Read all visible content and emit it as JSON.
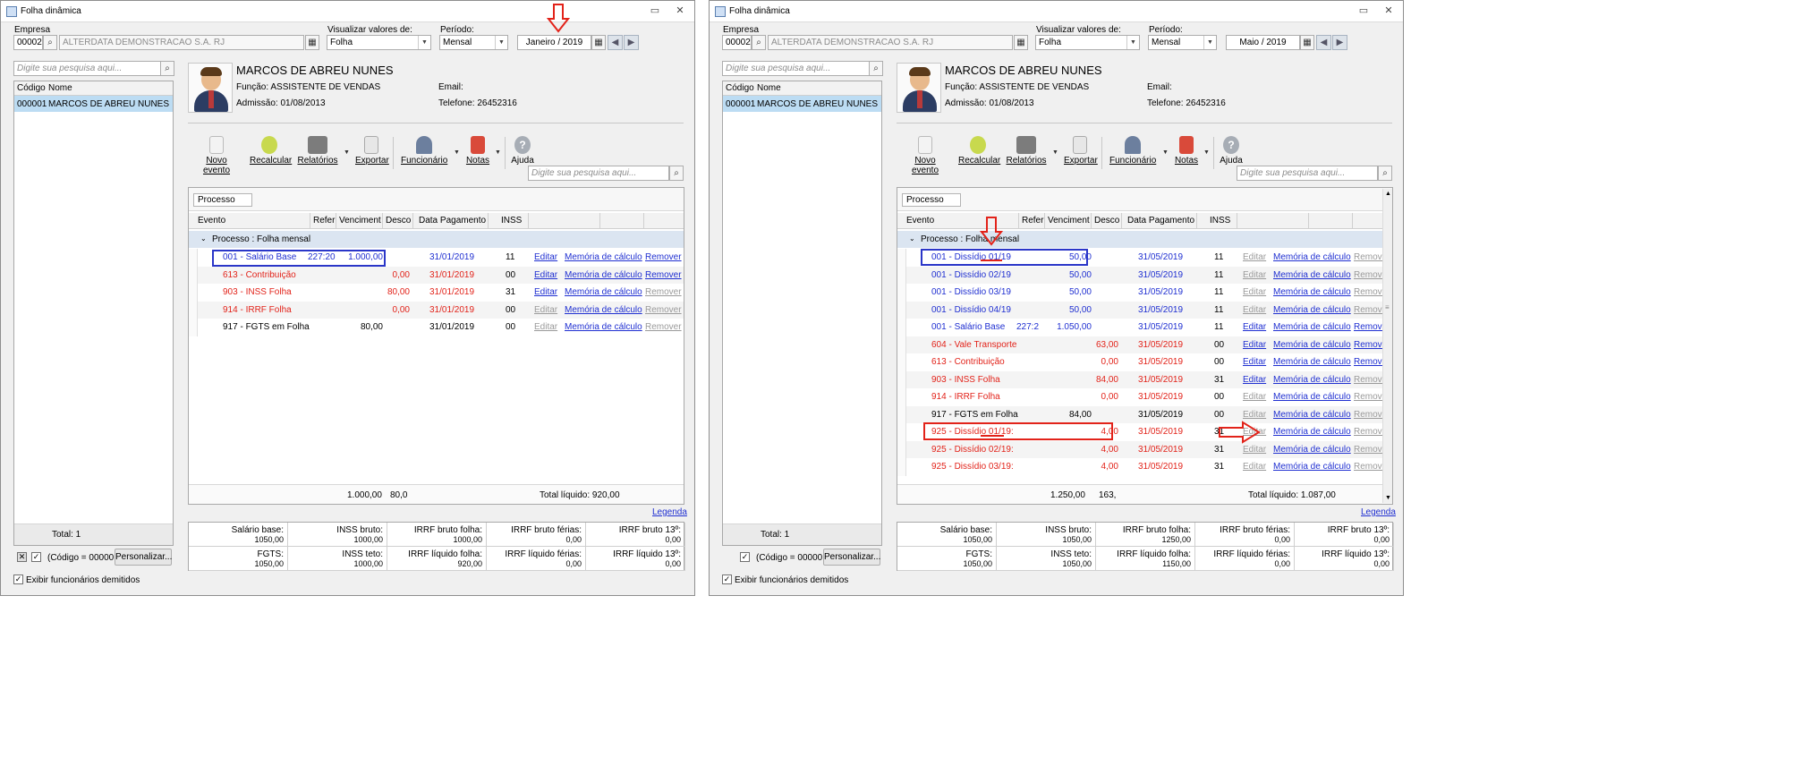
{
  "window_title": "Folha dinâmica",
  "labels": {
    "empresa": "Empresa",
    "visualizar": "Visualizar valores de:",
    "periodo": "Período:",
    "search_placeholder": "Digite sua pesquisa aqui...",
    "col_codigo": "Código",
    "col_nome": "Nome",
    "total_list": "Total: 1",
    "filter_text": "(Código = 00000",
    "personalizar": "Personalizar...",
    "exibir_demitidos": "Exibir funcionários demitidos",
    "processo_btn": "Processo",
    "legenda": "Legenda",
    "group_label": "Processo : Folha mensal"
  },
  "company": {
    "code": "00002",
    "name": "ALTERDATA DEMONSTRACAO S.A. RJ"
  },
  "view_values": "Folha",
  "period_type": "Mensal",
  "employee": {
    "code": "000001",
    "name": "MARCOS DE ABREU NUNES",
    "funcao": "Função: ASSISTENTE DE VENDAS",
    "admissao": "Admissão: 01/08/2013",
    "email": "Email:",
    "telefone": "Telefone: 26452316"
  },
  "toolbar": {
    "novo_evento": "Novo evento",
    "recalcular": "Recalcular",
    "relatorios": "Relatórios",
    "exportar": "Exportar",
    "funcionario": "Funcionário",
    "notas": "Notas",
    "ajuda": "Ajuda"
  },
  "columns": [
    "Evento",
    "Refer",
    "Venciment",
    "Desco",
    "Data Pagamento",
    "INSS"
  ],
  "actions": {
    "editar": "Editar",
    "memoria": "Memória de cálculo",
    "remover": "Remover"
  },
  "summary_labels": [
    "Salário base:",
    "INSS bruto:",
    "IRRF bruto folha:",
    "IRRF bruto férias:",
    "IRRF bruto 13º:",
    "FGTS:",
    "INSS teto:",
    "IRRF líquido folha:",
    "IRRF líquido férias:",
    "IRRF líquido 13º:"
  ],
  "left": {
    "period": "Janeiro / 2019",
    "rows": [
      {
        "evento": "001 - Salário Base",
        "refer": "227:20",
        "venc": "1.000,00",
        "desc": "",
        "data": "31/01/2019",
        "inss": "11",
        "color": "blue",
        "ed": true,
        "rm": true
      },
      {
        "evento": "613 - Contribuição",
        "refer": "",
        "venc": "",
        "desc": "0,00",
        "data": "31/01/2019",
        "inss": "00",
        "color": "red",
        "ed": true,
        "rm": true
      },
      {
        "evento": "903 - INSS Folha",
        "refer": "",
        "venc": "",
        "desc": "80,00",
        "data": "31/01/2019",
        "inss": "31",
        "color": "red",
        "ed": true,
        "rm": false
      },
      {
        "evento": "914 - IRRF Folha",
        "refer": "",
        "venc": "",
        "desc": "0,00",
        "data": "31/01/2019",
        "inss": "00",
        "color": "red",
        "ed": false,
        "rm": false
      },
      {
        "evento": "917 - FGTS em Folha",
        "refer": "",
        "venc": "80,00",
        "desc": "",
        "data": "31/01/2019",
        "inss": "00",
        "color": "dk",
        "ed": false,
        "rm": false
      }
    ],
    "foot_venc": "1.000,00",
    "foot_desc": "80,0",
    "total_liquido": "Total líquido: 920,00",
    "summary_values": [
      "1050,00",
      "1000,00",
      "1000,00",
      "0,00",
      "0,00",
      "1050,00",
      "1000,00",
      "920,00",
      "0,00",
      "0,00"
    ]
  },
  "right": {
    "period": "Maio / 2019",
    "rows": [
      {
        "evento": "001 - Dissídio 01/19",
        "refer": "",
        "venc": "50,00",
        "desc": "",
        "data": "31/05/2019",
        "inss": "11",
        "color": "blue",
        "ed": false,
        "rm": false
      },
      {
        "evento": "001 - Dissídio 02/19",
        "refer": "",
        "venc": "50,00",
        "desc": "",
        "data": "31/05/2019",
        "inss": "11",
        "color": "blue",
        "ed": false,
        "rm": false
      },
      {
        "evento": "001 - Dissídio 03/19",
        "refer": "",
        "venc": "50,00",
        "desc": "",
        "data": "31/05/2019",
        "inss": "11",
        "color": "blue",
        "ed": false,
        "rm": false
      },
      {
        "evento": "001 - Dissídio 04/19",
        "refer": "",
        "venc": "50,00",
        "desc": "",
        "data": "31/05/2019",
        "inss": "11",
        "color": "blue",
        "ed": false,
        "rm": false
      },
      {
        "evento": "001 - Salário Base",
        "refer": "227:2",
        "venc": "1.050,00",
        "desc": "",
        "data": "31/05/2019",
        "inss": "11",
        "color": "blue",
        "ed": true,
        "rm": true
      },
      {
        "evento": "604 - Vale Transporte",
        "refer": "",
        "venc": "",
        "desc": "63,00",
        "data": "31/05/2019",
        "inss": "00",
        "color": "red",
        "ed": true,
        "rm": true
      },
      {
        "evento": "613 - Contribuição",
        "refer": "",
        "venc": "",
        "desc": "0,00",
        "data": "31/05/2019",
        "inss": "00",
        "color": "red",
        "ed": true,
        "rm": true
      },
      {
        "evento": "903 - INSS Folha",
        "refer": "",
        "venc": "",
        "desc": "84,00",
        "data": "31/05/2019",
        "inss": "31",
        "color": "red",
        "ed": true,
        "rm": false
      },
      {
        "evento": "914 - IRRF Folha",
        "refer": "",
        "venc": "",
        "desc": "0,00",
        "data": "31/05/2019",
        "inss": "00",
        "color": "red",
        "ed": false,
        "rm": false
      },
      {
        "evento": "917 - FGTS em Folha",
        "refer": "",
        "venc": "84,00",
        "desc": "",
        "data": "31/05/2019",
        "inss": "00",
        "color": "dk",
        "ed": false,
        "rm": false
      },
      {
        "evento": "925 - Dissídio 01/19:",
        "refer": "",
        "venc": "",
        "desc": "4,00",
        "data": "31/05/2019",
        "inss": "31",
        "color": "red",
        "ed": false,
        "rm": false
      },
      {
        "evento": "925 - Dissídio 02/19:",
        "refer": "",
        "venc": "",
        "desc": "4,00",
        "data": "31/05/2019",
        "inss": "31",
        "color": "red",
        "ed": false,
        "rm": false
      },
      {
        "evento": "925 - Dissídio 03/19:",
        "refer": "",
        "venc": "",
        "desc": "4,00",
        "data": "31/05/2019",
        "inss": "31",
        "color": "red",
        "ed": false,
        "rm": false
      }
    ],
    "foot_venc": "1.250,00",
    "foot_desc": "163,",
    "total_liquido": "Total líquido: 1.087,00",
    "summary_values": [
      "1050,00",
      "1050,00",
      "1250,00",
      "0,00",
      "0,00",
      "1050,00",
      "1050,00",
      "1150,00",
      "0,00",
      "0,00"
    ]
  },
  "colors": {
    "blue": "#1f2fd1",
    "red": "#e2231a",
    "selection": "#bcdcf3",
    "group": "#dbe5f1"
  }
}
